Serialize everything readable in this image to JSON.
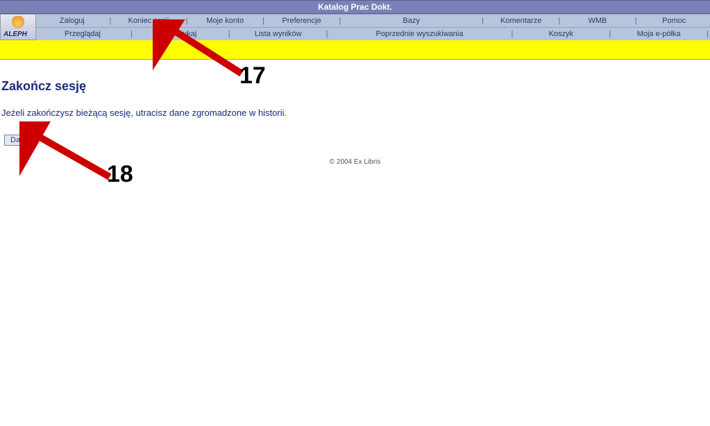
{
  "title_bar": "Katalog Prac Dokt.",
  "logo": {
    "text": "ALEPH"
  },
  "nav_row1": {
    "items": [
      "Zaloguj",
      "Koniec sesji",
      "Moje konto",
      "Preferencje",
      "Bazy",
      "Komentarze",
      "WMB",
      "Pomoc"
    ]
  },
  "nav_row2": {
    "items": [
      "Przeglądaj",
      "Wyszukaj",
      "Lista wyników",
      "Poprzednie wyszukiwania",
      "Koszyk",
      "Moja e-półka"
    ]
  },
  "page_title": "Zakończ sesję",
  "message": "Jeżeli zakończysz bieżącą sesję, utracisz dane zgromadzone w historii.",
  "button_next": "Dalej",
  "footer": "© 2004 Ex Libris",
  "annotations": {
    "arrow17_label": "17",
    "arrow18_label": "18"
  }
}
